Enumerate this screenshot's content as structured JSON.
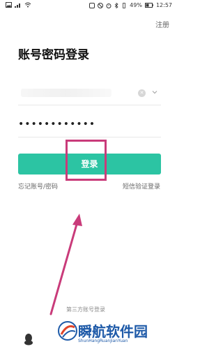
{
  "statusbar": {
    "battery": "49%",
    "time": "12:57"
  },
  "header": {
    "register_link": "注册"
  },
  "page": {
    "title": "账号密码登录"
  },
  "form": {
    "password_value": "••••••••••••",
    "login_label": "登录"
  },
  "links": {
    "forgot": "忘记账号/密码",
    "sms_login": "短信验证登录"
  },
  "footer": {
    "third_party_label": "第三方账号登录"
  },
  "watermark": {
    "title": "瞬航软件园",
    "subtitle": "ShunHangRuanJianYuan"
  },
  "colors": {
    "accent": "#2cc4a3",
    "annotation": "#c93b7a",
    "watermark": "#1e5aa8"
  }
}
